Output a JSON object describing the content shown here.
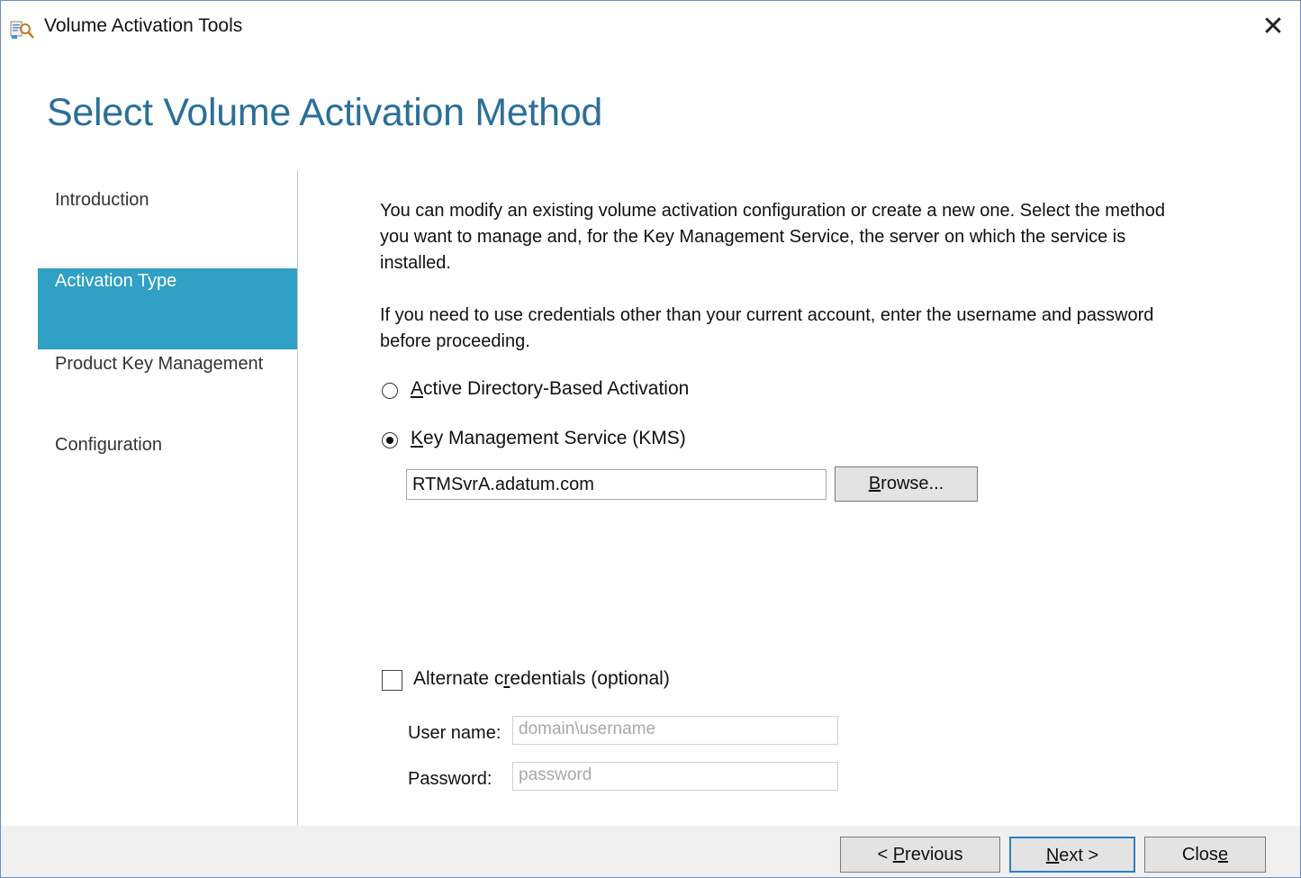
{
  "window": {
    "title": "Volume Activation Tools",
    "close_symbol": "✕"
  },
  "page": {
    "heading": "Select Volume Activation Method"
  },
  "nav": {
    "items": [
      {
        "label": "Introduction",
        "active": false
      },
      {
        "label": "Activation Type",
        "active": true
      },
      {
        "label": "Product Key Management",
        "active": false
      },
      {
        "label": "Configuration",
        "active": false
      }
    ]
  },
  "content": {
    "intro_line1": "You can modify an existing volume activation configuration or create a new one. Select the method",
    "intro_line2": "you want to manage and, for the Key Management Service, the server on which the service is",
    "intro_line3": "installed.",
    "credentials_line1": "If you need to use credentials other than your current account, enter the username and password",
    "credentials_line2": "before proceeding.",
    "methods": [
      {
        "access_key": "A",
        "label_rest": "ctive Directory-Based Activation",
        "selected": false
      },
      {
        "access_key": "K",
        "label_rest": "ey Management Service (KMS)",
        "selected": true
      }
    ],
    "kms_server": {
      "value": "RTMSvrA.adatum.com"
    },
    "browse_button": {
      "access_key": "B",
      "label_rest": "rowse..."
    },
    "alternate_credentials": {
      "label_before": "Alternate c",
      "access_key": "r",
      "label_after": "edentials (optional)",
      "checked": false
    },
    "username": {
      "label": "User name:",
      "placeholder": "domain\\username"
    },
    "password": {
      "label": "Password:",
      "placeholder": "password"
    }
  },
  "footer": {
    "previous": {
      "prefix": "< ",
      "access_key": "P",
      "label_rest": "revious"
    },
    "next": {
      "access_key": "N",
      "label_rest": "ext >"
    },
    "close": {
      "label_before": "Clos",
      "access_key": "e"
    }
  }
}
